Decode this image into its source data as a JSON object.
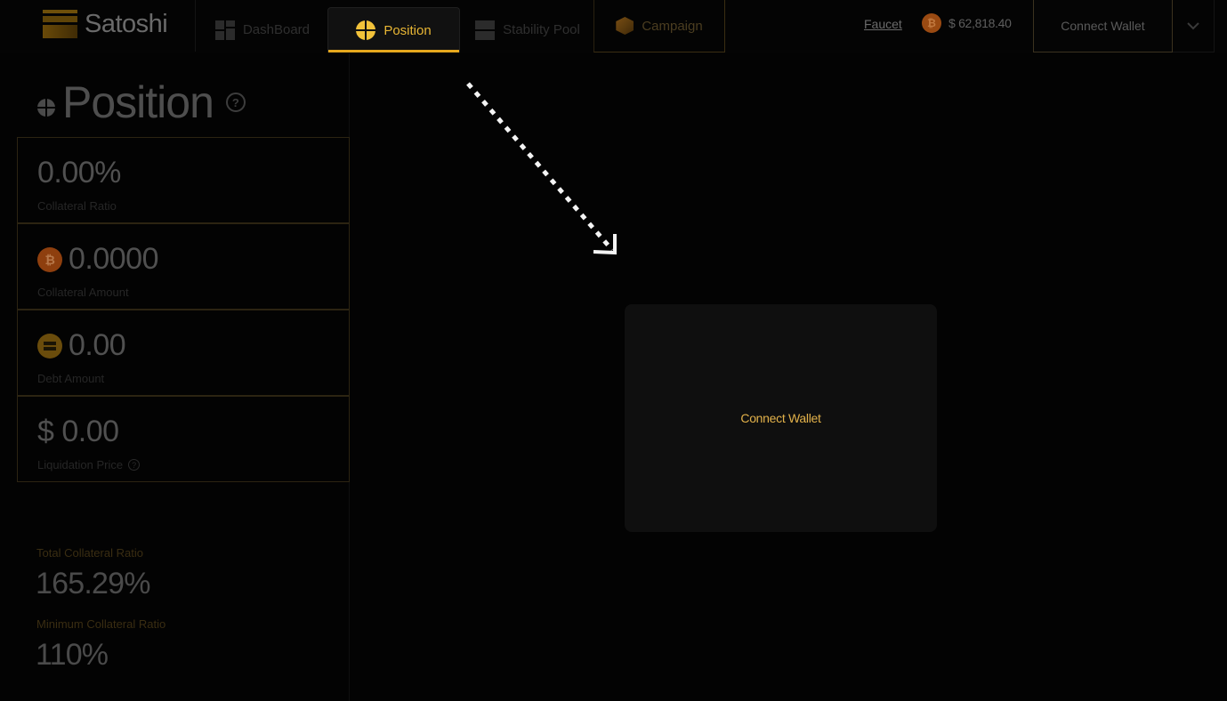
{
  "header": {
    "brand": "Satoshi",
    "nav_tabs": [
      {
        "label": "DashBoard",
        "icon": "dashboard-grid-icon",
        "active": false
      },
      {
        "label": "Position",
        "icon": "position-crosshair-icon",
        "active": true
      },
      {
        "label": "Stability Pool",
        "icon": "stability-pool-icon",
        "active": false
      },
      {
        "label": "Campaign",
        "icon": "campaign-hexagon-icon",
        "active": false
      }
    ],
    "faucet_label": "Faucet",
    "btc_symbol": "₿",
    "btc_price": "$ 62,818.40",
    "connect_wallet_label": "Connect Wallet",
    "dropdown_icon": "chevron-down-icon"
  },
  "left_panel": {
    "title": "Position",
    "help_glyph": "?",
    "stats": [
      {
        "value": "0.00%",
        "label": "Collateral Ratio"
      },
      {
        "value": "0.0000",
        "label": "Collateral Amount",
        "coin": "₿"
      },
      {
        "value": "0.00",
        "label": "Debt Amount"
      },
      {
        "value": "$ 0.00",
        "label": "Liquidation Price",
        "help": "?"
      }
    ],
    "summary": {
      "total_collateral_ratio_label": "Total Collateral Ratio",
      "total_collateral_ratio_value": "165.29%",
      "minimum_collateral_ratio_label": "Minimum Collateral Ratio",
      "minimum_collateral_ratio_value": "110%"
    }
  },
  "main": {
    "connect_wallet_label": "Connect Wallet"
  },
  "colors": {
    "accent": "#e6a81d",
    "accent_text": "#e2b14a",
    "background": "#030303",
    "card": "#0f0f0f",
    "btc_orange": "#8e3f0e"
  }
}
